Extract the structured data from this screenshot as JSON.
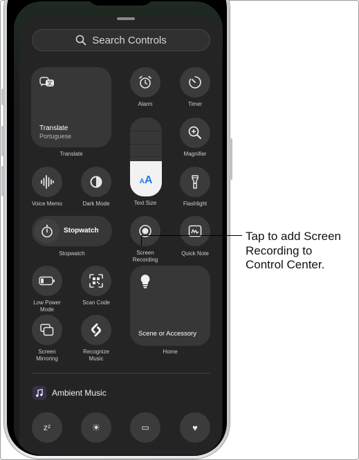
{
  "search": {
    "placeholder": "Search Controls"
  },
  "controls": {
    "translate": {
      "title": "Translate",
      "subtitle": "Portuguese",
      "label": "Translate"
    },
    "alarm": {
      "label": "Alarm"
    },
    "timer": {
      "label": "Timer"
    },
    "magnifier": {
      "label": "Magnifier"
    },
    "text_size": {
      "label": "Text Size",
      "glyph": "AA",
      "level": 0.45
    },
    "voice_memo": {
      "label": "Voice Memo"
    },
    "dark_mode": {
      "label": "Dark Mode"
    },
    "flashlight": {
      "label": "Flashlight"
    },
    "stopwatch": {
      "title": "Stopwatch",
      "label": "Stopwatch"
    },
    "screen_recording": {
      "label": "Screen\nRecording"
    },
    "quick_note": {
      "label": "Quick Note"
    },
    "low_power": {
      "label": "Low Power\nMode"
    },
    "scan_code": {
      "label": "Scan Code"
    },
    "home": {
      "title": "Scene or Accessory",
      "label": "Home"
    },
    "screen_mirroring": {
      "label": "Screen\nMirroring"
    },
    "recognize_music": {
      "label": "Recognize\nMusic"
    }
  },
  "section": {
    "title": "Ambient Music"
  },
  "callout": {
    "text": "Tap to add Screen\nRecording to\nControl Center."
  },
  "colors": {
    "accent": "#1e7cf0",
    "sheet": "#232423",
    "control": "#3a3b3a"
  }
}
